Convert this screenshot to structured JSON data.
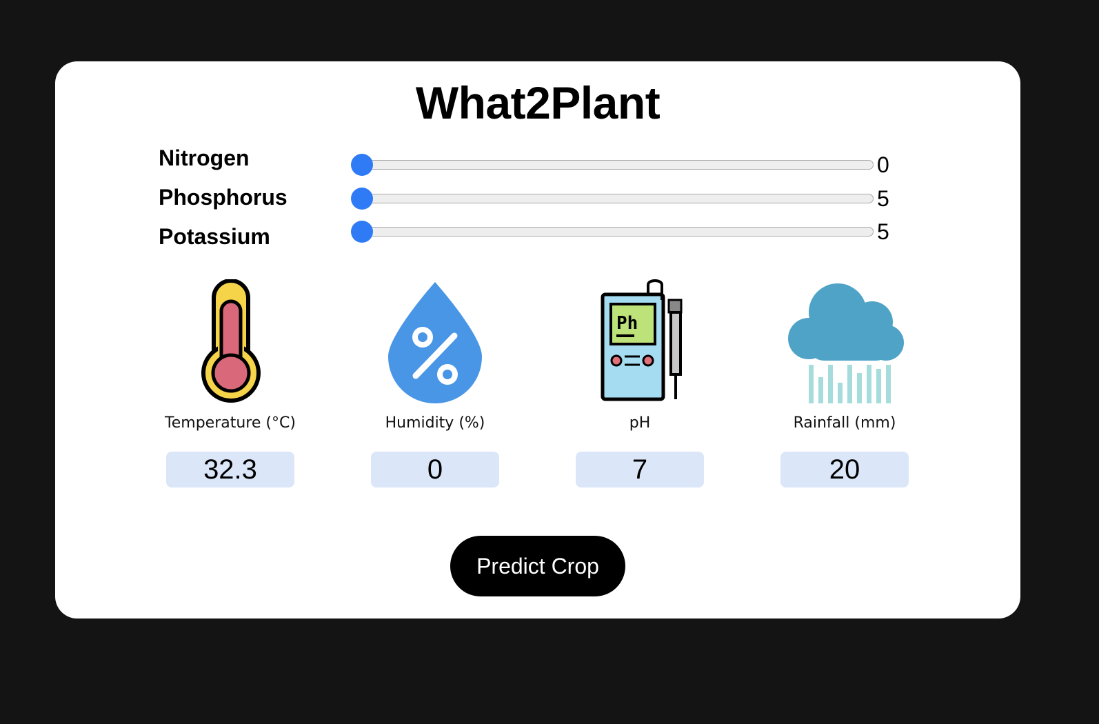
{
  "app": {
    "title": "What2Plant"
  },
  "sliders": [
    {
      "label": "Nitrogen",
      "value": "0"
    },
    {
      "label": "Phosphorus",
      "value": "5"
    },
    {
      "label": "Potassium",
      "value": "5"
    }
  ],
  "metrics": [
    {
      "label": "Temperature (°C)",
      "value": "32.3",
      "icon": "thermometer-icon"
    },
    {
      "label": "Humidity (%)",
      "value": "0",
      "icon": "humidity-drop-icon"
    },
    {
      "label": "pH",
      "value": "7",
      "icon": "ph-meter-icon"
    },
    {
      "label": "Rainfall (mm)",
      "value": "20",
      "icon": "rain-cloud-icon"
    }
  ],
  "actions": {
    "predict_label": "Predict Crop"
  },
  "colors": {
    "background": "#141414",
    "card": "#ffffff",
    "accent": "#2f7bf5",
    "input_bg": "#dbe7f8",
    "button": "#000000"
  }
}
